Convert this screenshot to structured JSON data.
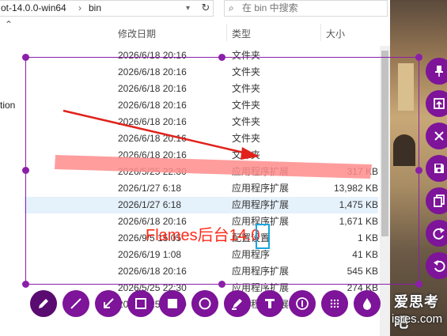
{
  "explorer": {
    "address": {
      "partial_path": "ot-14.0.0-win64",
      "current_folder": "bin"
    },
    "search_placeholder": "在 bin 中搜索",
    "left_partial_label": "tion",
    "columns": {
      "date": "修改日期",
      "type": "类型",
      "size": "大小"
    },
    "rows": [
      {
        "date": "2026/6/18 20:16",
        "type": "文件夹",
        "size": ""
      },
      {
        "date": "2026/6/18 20:16",
        "type": "文件夹",
        "size": ""
      },
      {
        "date": "2026/6/18 20:16",
        "type": "文件夹",
        "size": ""
      },
      {
        "date": "2026/6/18 20:16",
        "type": "文件夹",
        "size": ""
      },
      {
        "date": "2026/6/18 20:16",
        "type": "文件夹",
        "size": ""
      },
      {
        "date": "2026/6/18 20:16",
        "type": "文件夹",
        "size": ""
      },
      {
        "date": "2026/6/18 20:16",
        "type": "文件夹",
        "size": ""
      },
      {
        "date": "2026/5/25 22:30",
        "type": "应用程序扩展",
        "size": "317 KB"
      },
      {
        "date": "2026/1/27 6:18",
        "type": "应用程序扩展",
        "size": "13,982 KB"
      },
      {
        "date": "2026/1/27 6:18",
        "type": "应用程序扩展",
        "size": "1,475 KB"
      },
      {
        "date": "2026/6/18 20:16",
        "type": "应用程序扩展",
        "size": "1,671 KB"
      },
      {
        "date": "2026/9/5 15:05",
        "type": "配置设置",
        "size": "1 KB"
      },
      {
        "date": "2026/6/19 1:08",
        "type": "应用程序",
        "size": "41 KB"
      },
      {
        "date": "2026/6/18 20:16",
        "type": "应用程序扩展",
        "size": "545 KB"
      },
      {
        "date": "2026/5/25 22:30",
        "type": "应用程序扩展",
        "size": "274 KB"
      },
      {
        "date": "2026/5/25 22:30",
        "type": "应用程序扩展",
        "size": ""
      }
    ]
  },
  "annotation": {
    "text": "Flames后台14.0"
  },
  "watermark": {
    "main": "爱思考吧",
    "sub": "isres.com"
  },
  "colors": {
    "accent": "#7d1499",
    "annotation_red": "#ff2a1a",
    "highlighter": "#ff8c8c",
    "text_cursor": "#1aa5e0"
  },
  "toolbar_icons": [
    "pen-icon",
    "line-icon",
    "arrow-icon",
    "rectangle-icon",
    "filled-rectangle-icon",
    "ellipse-icon",
    "marker-icon",
    "text-icon",
    "counter-icon",
    "mosaic-icon",
    "blur-icon"
  ],
  "side_icons": [
    "pin-icon",
    "upload-icon",
    "close-icon",
    "save-icon",
    "copy-icon",
    "redo-icon",
    "undo-icon"
  ]
}
